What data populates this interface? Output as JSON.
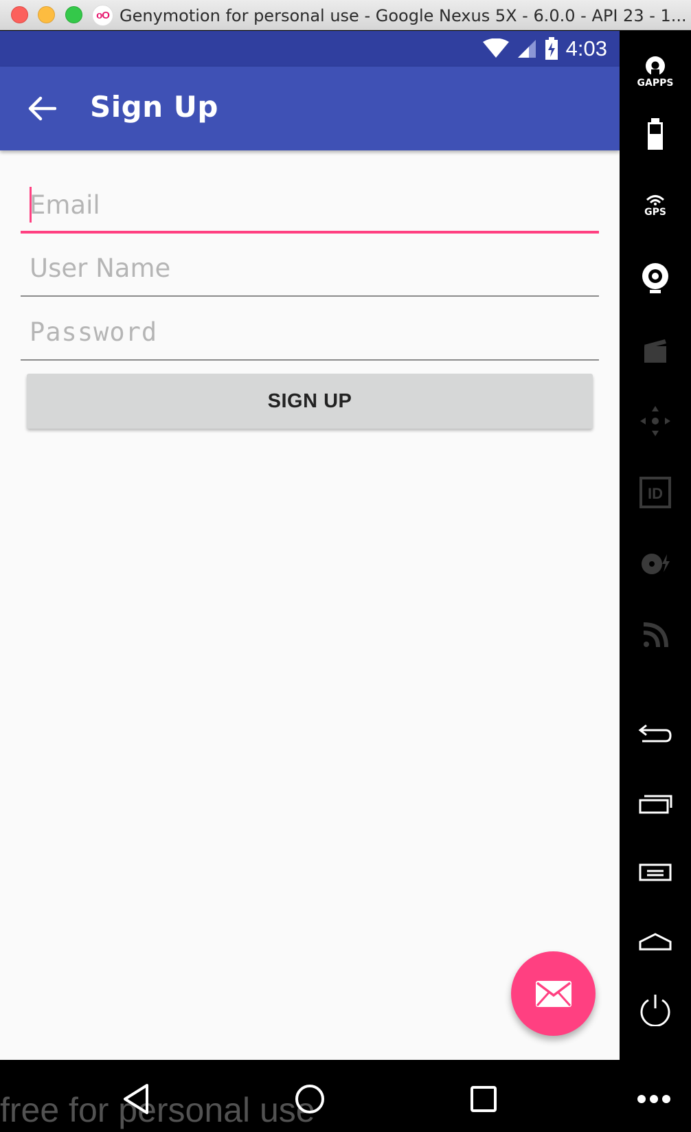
{
  "window": {
    "title": "Genymotion for personal use - Google Nexus 5X - 6.0.0 - API 23 - 1...",
    "logo_text": "oO"
  },
  "statusbar": {
    "time": "4:03"
  },
  "appbar": {
    "title": "Sign Up",
    "back_icon": "arrow-back-icon"
  },
  "form": {
    "email": {
      "placeholder": "Email",
      "value": ""
    },
    "username": {
      "placeholder": "User Name",
      "value": ""
    },
    "password": {
      "placeholder": "Password",
      "value": ""
    },
    "signup_label": "SIGN UP"
  },
  "fab": {
    "icon": "mail-icon"
  },
  "toolbar": {
    "gapps_label": "GAPPS",
    "gps_label": "GPS",
    "id_label": "ID"
  },
  "watermark": "free for personal use",
  "colors": {
    "primary": "#3f51b5",
    "primary_dark": "#303f9f",
    "accent": "#ff4081"
  }
}
